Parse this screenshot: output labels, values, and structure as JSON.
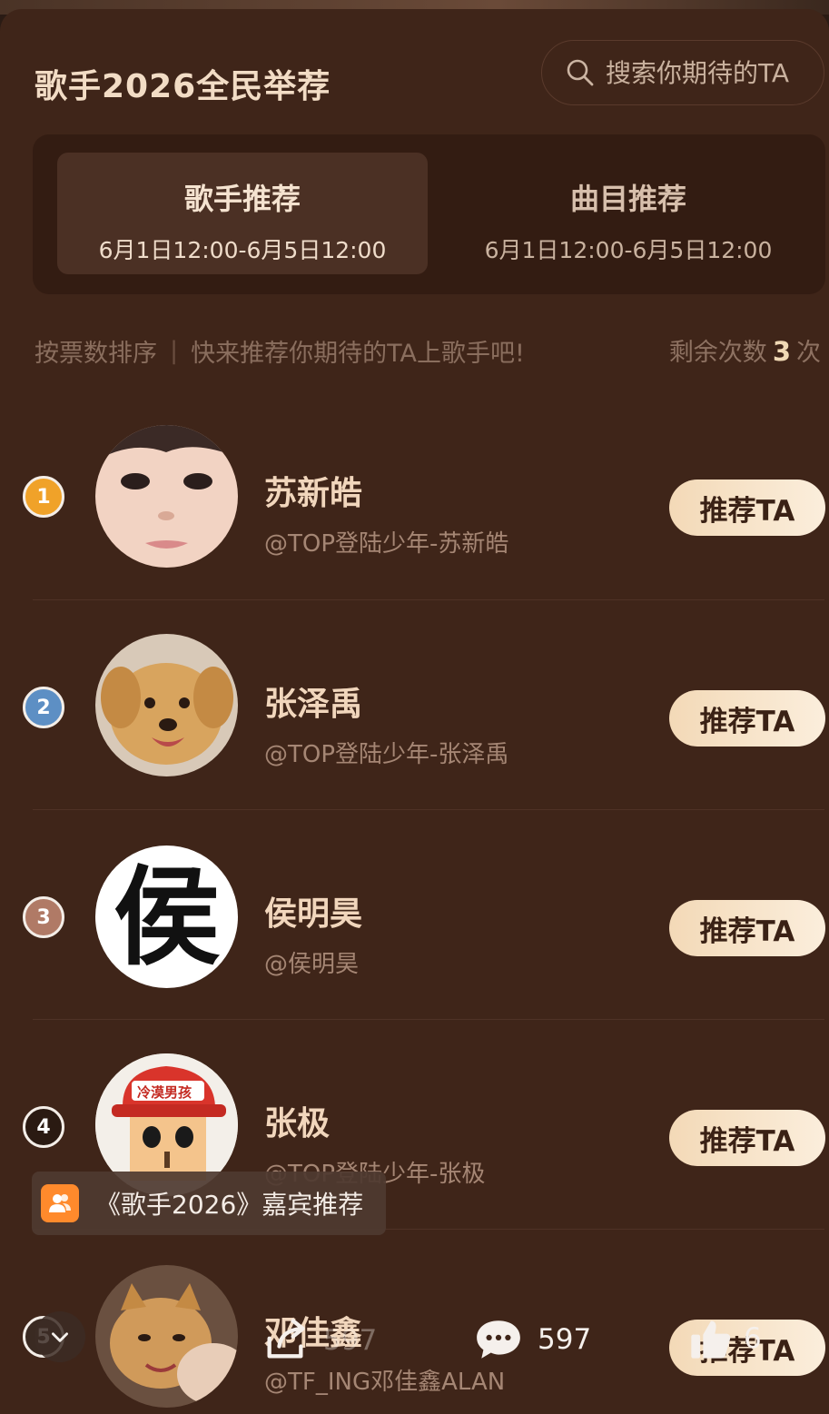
{
  "header": {
    "title": "歌手2026全民举荐",
    "search_placeholder": "搜索你期待的TA"
  },
  "tabs": [
    {
      "label": "歌手推荐",
      "date": "6月1日12:00-6月5日12:00",
      "active": true
    },
    {
      "label": "曲目推荐",
      "date": "6月1日12:00-6月5日12:00",
      "active": false
    }
  ],
  "sortbar": {
    "sort_label": "按票数排序",
    "separator": "|",
    "hint": "快来推荐你期待的TA上歌手吧!",
    "remaining_prefix": "剩余次数",
    "remaining_count": "3",
    "remaining_suffix": "次"
  },
  "candidates": [
    {
      "rank": "1",
      "name": "苏新皓",
      "handle": "@TOP登陆少年-苏新皓",
      "button": "推荐TA",
      "rank_color": "#f0a229"
    },
    {
      "rank": "2",
      "name": "张泽禹",
      "handle": "@TOP登陆少年-张泽禹",
      "button": "推荐TA",
      "rank_color": "#5d8fc4"
    },
    {
      "rank": "3",
      "name": "侯明昊",
      "handle": "@侯明昊",
      "button": "推荐TA",
      "rank_color": "#b07a66",
      "avatar_char": "侯"
    },
    {
      "rank": "4",
      "name": "张极",
      "handle": "@TOP登陆少年-张极",
      "button": "推荐TA",
      "rank_color": "#2a1a12",
      "avatar_text": "冷漠男孩"
    },
    {
      "rank": "5",
      "name": "邓佳鑫",
      "handle": "@TF_ING邓佳鑫ALAN",
      "button": "推荐TA",
      "rank_color": "#3a2a22"
    }
  ],
  "tooltip": {
    "text": "《歌手2026》嘉宾推荐"
  },
  "overlay": {
    "share_count": "597",
    "comment_count": "597",
    "like_count": "6"
  }
}
